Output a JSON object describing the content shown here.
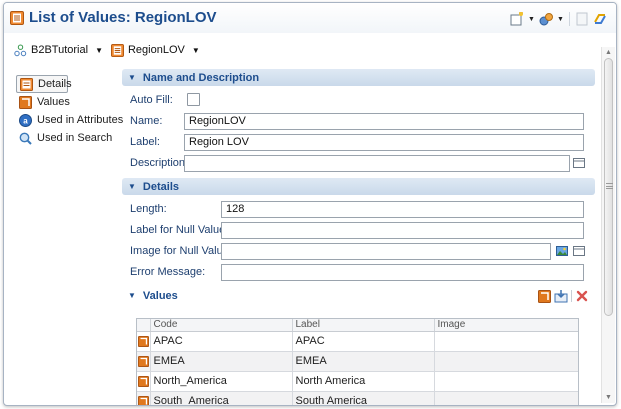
{
  "window": {
    "title": "List of Values: RegionLOV"
  },
  "breadcrumb": [
    {
      "label": "B2BTutorial",
      "icon": "application-icon"
    },
    {
      "label": "RegionLOV",
      "icon": "lov-icon"
    }
  ],
  "nav": {
    "items": [
      {
        "label": "Details",
        "icon": "details-icon",
        "active": true
      },
      {
        "label": "Values",
        "icon": "values-icon"
      },
      {
        "label": "Used in Attributes",
        "icon": "attribute-icon"
      },
      {
        "label": "Used in Search",
        "icon": "search-icon"
      }
    ]
  },
  "sections": {
    "name_desc": {
      "title": "Name and Description",
      "auto_fill_label": "Auto Fill:",
      "name_label": "Name:",
      "name_value": "RegionLOV",
      "label_label": "Label:",
      "label_value": "Region LOV",
      "description_label": "Description:",
      "description_value": ""
    },
    "details": {
      "title": "Details",
      "length_label": "Length:",
      "length_value": "128",
      "null_label_label": "Label for Null Value:",
      "null_label_value": "",
      "null_image_label": "Image for Null Value:",
      "null_image_value": "",
      "error_label": "Error Message:",
      "error_value": ""
    },
    "values": {
      "title": "Values",
      "columns": [
        "Code",
        "Label",
        "Image"
      ],
      "rows": [
        {
          "code": "APAC",
          "label": "APAC",
          "image": ""
        },
        {
          "code": "EMEA",
          "label": "EMEA",
          "image": ""
        },
        {
          "code": "North_America",
          "label": "North America",
          "image": ""
        },
        {
          "code": "South_America",
          "label": "South America",
          "image": ""
        }
      ]
    }
  },
  "colors": {
    "title_blue": "#1d4d8d",
    "section_band": "#c9d9ea",
    "lov_orange": "#e0781e",
    "delete_red": "#d9534f"
  }
}
